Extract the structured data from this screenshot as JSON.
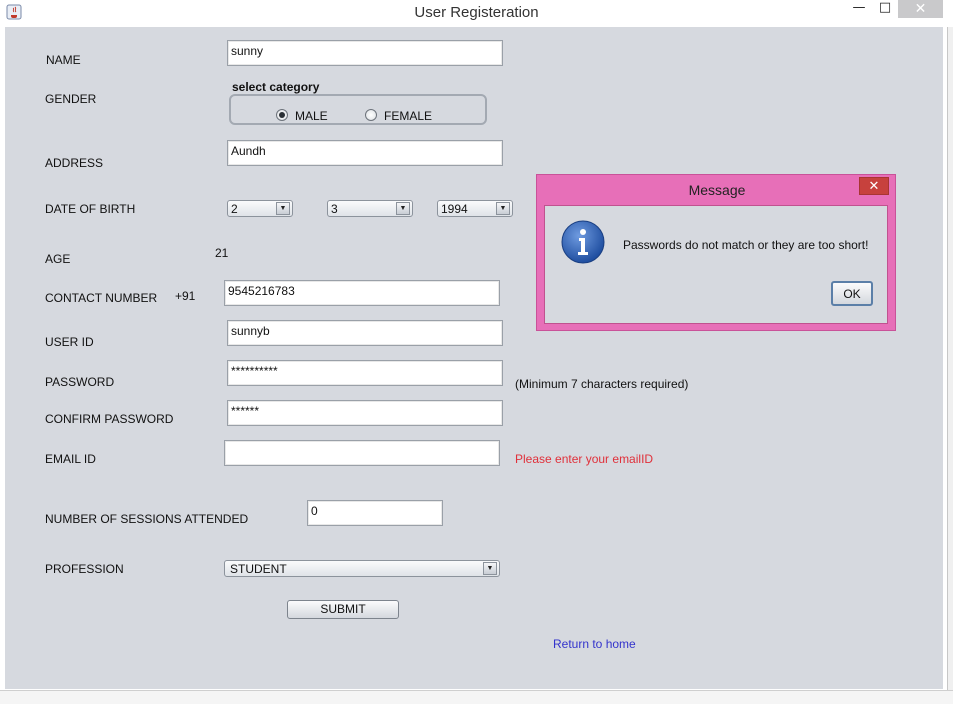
{
  "window": {
    "title": "User Registeration",
    "minimize_glyph": "—",
    "maximize_glyph": "□",
    "close_glyph": "✕"
  },
  "form": {
    "name_label": "NAME",
    "name_value": "sunny",
    "gender_label": "GENDER",
    "category_title": "select category",
    "male_label": "MALE",
    "female_label": "FEMALE",
    "selected_gender": "MALE",
    "address_label": "ADDRESS",
    "address_value": "Aundh",
    "dob_label": "DATE OF BIRTH",
    "dob_day": "2",
    "dob_month": "3",
    "dob_year": "1994",
    "age_label": "AGE",
    "age_value": "21",
    "contact_label": "CONTACT NUMBER",
    "contact_prefix": "+91",
    "contact_value": "9545216783",
    "userid_label": "USER ID",
    "userid_value": "sunnyb",
    "password_label": "PASSWORD",
    "password_value": "**********",
    "password_hint": "(Minimum 7 characters required)",
    "confirm_label": "CONFIRM PASSWORD",
    "confirm_value": "******",
    "email_label": "EMAIL ID",
    "email_value": "",
    "email_error": "Please enter your emailID",
    "sessions_label": "NUMBER OF SESSIONS ATTENDED",
    "sessions_value": "0",
    "profession_label": "PROFESSION",
    "profession_value": "STUDENT",
    "submit_label": "SUBMIT",
    "return_link": "Return to home"
  },
  "dialog": {
    "title": "Message",
    "message": "Passwords do not match or they are too short!",
    "ok_label": "OK",
    "close_glyph": "✕"
  },
  "colors": {
    "panel_bg": "#d6d9df",
    "dialog_frame": "#e76fb8",
    "dialog_close": "#c7413d",
    "error_text": "#e0303a",
    "link_text": "#3333cc",
    "info_icon": "#2f5fb0"
  },
  "icons": {
    "app": "java-coffee-cup-icon",
    "dialog": "information-icon",
    "dropdown": "chevron-down-icon"
  }
}
